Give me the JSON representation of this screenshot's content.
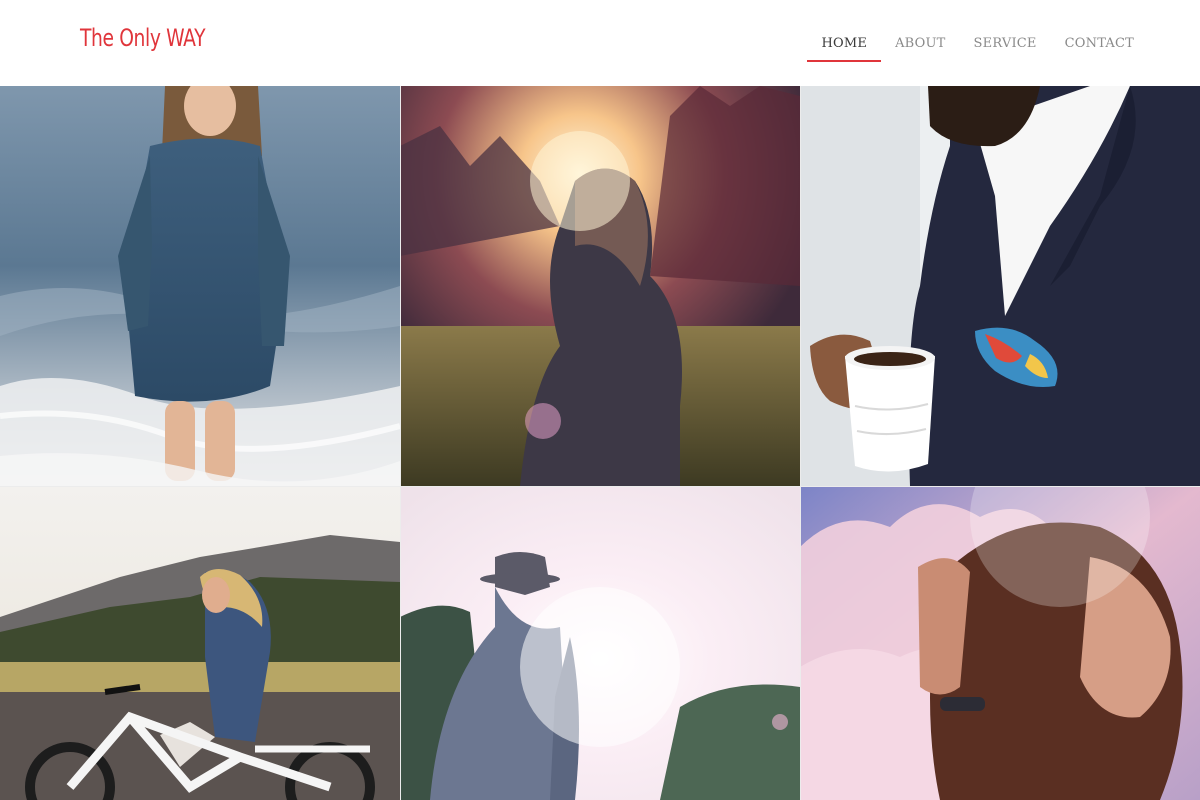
{
  "brand": {
    "logo_text": "The Only WAY",
    "accent_color": "#e0353b"
  },
  "nav": {
    "items": [
      {
        "label": "HOME",
        "active": true
      },
      {
        "label": "ABOUT",
        "active": false
      },
      {
        "label": "SERVICE",
        "active": false
      },
      {
        "label": "CONTACT",
        "active": false
      }
    ]
  },
  "gallery": {
    "tiles": [
      {
        "subject": "woman-in-sweater-at-sea-photo"
      },
      {
        "subject": "woman-in-sunset-field-photo"
      },
      {
        "subject": "man-with-coffee-cup-photo"
      },
      {
        "subject": "woman-riding-bicycle-photo"
      },
      {
        "subject": "man-in-hat-backlit-photo"
      },
      {
        "subject": "woman-against-pink-sky-photo"
      }
    ]
  }
}
